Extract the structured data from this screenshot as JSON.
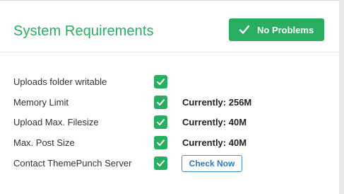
{
  "header": {
    "title": "System Requirements",
    "status_button": {
      "label": "No Problems",
      "icon": "checkmark-icon"
    }
  },
  "requirements": [
    {
      "name": "Uploads folder writable",
      "status": "ok",
      "value": ""
    },
    {
      "name": "Memory Limit",
      "status": "ok",
      "value": "Currently: 256M"
    },
    {
      "name": "Upload Max. Filesize",
      "status": "ok",
      "value": "Currently: 40M"
    },
    {
      "name": "Max. Post Size",
      "status": "ok",
      "value": "Currently: 40M"
    },
    {
      "name": "Contact ThemePunch Server",
      "status": "ok",
      "action_label": "Check Now"
    }
  ],
  "colors": {
    "accent_green": "#27ae60",
    "link_blue": "#2a78c2",
    "text": "#333333"
  }
}
